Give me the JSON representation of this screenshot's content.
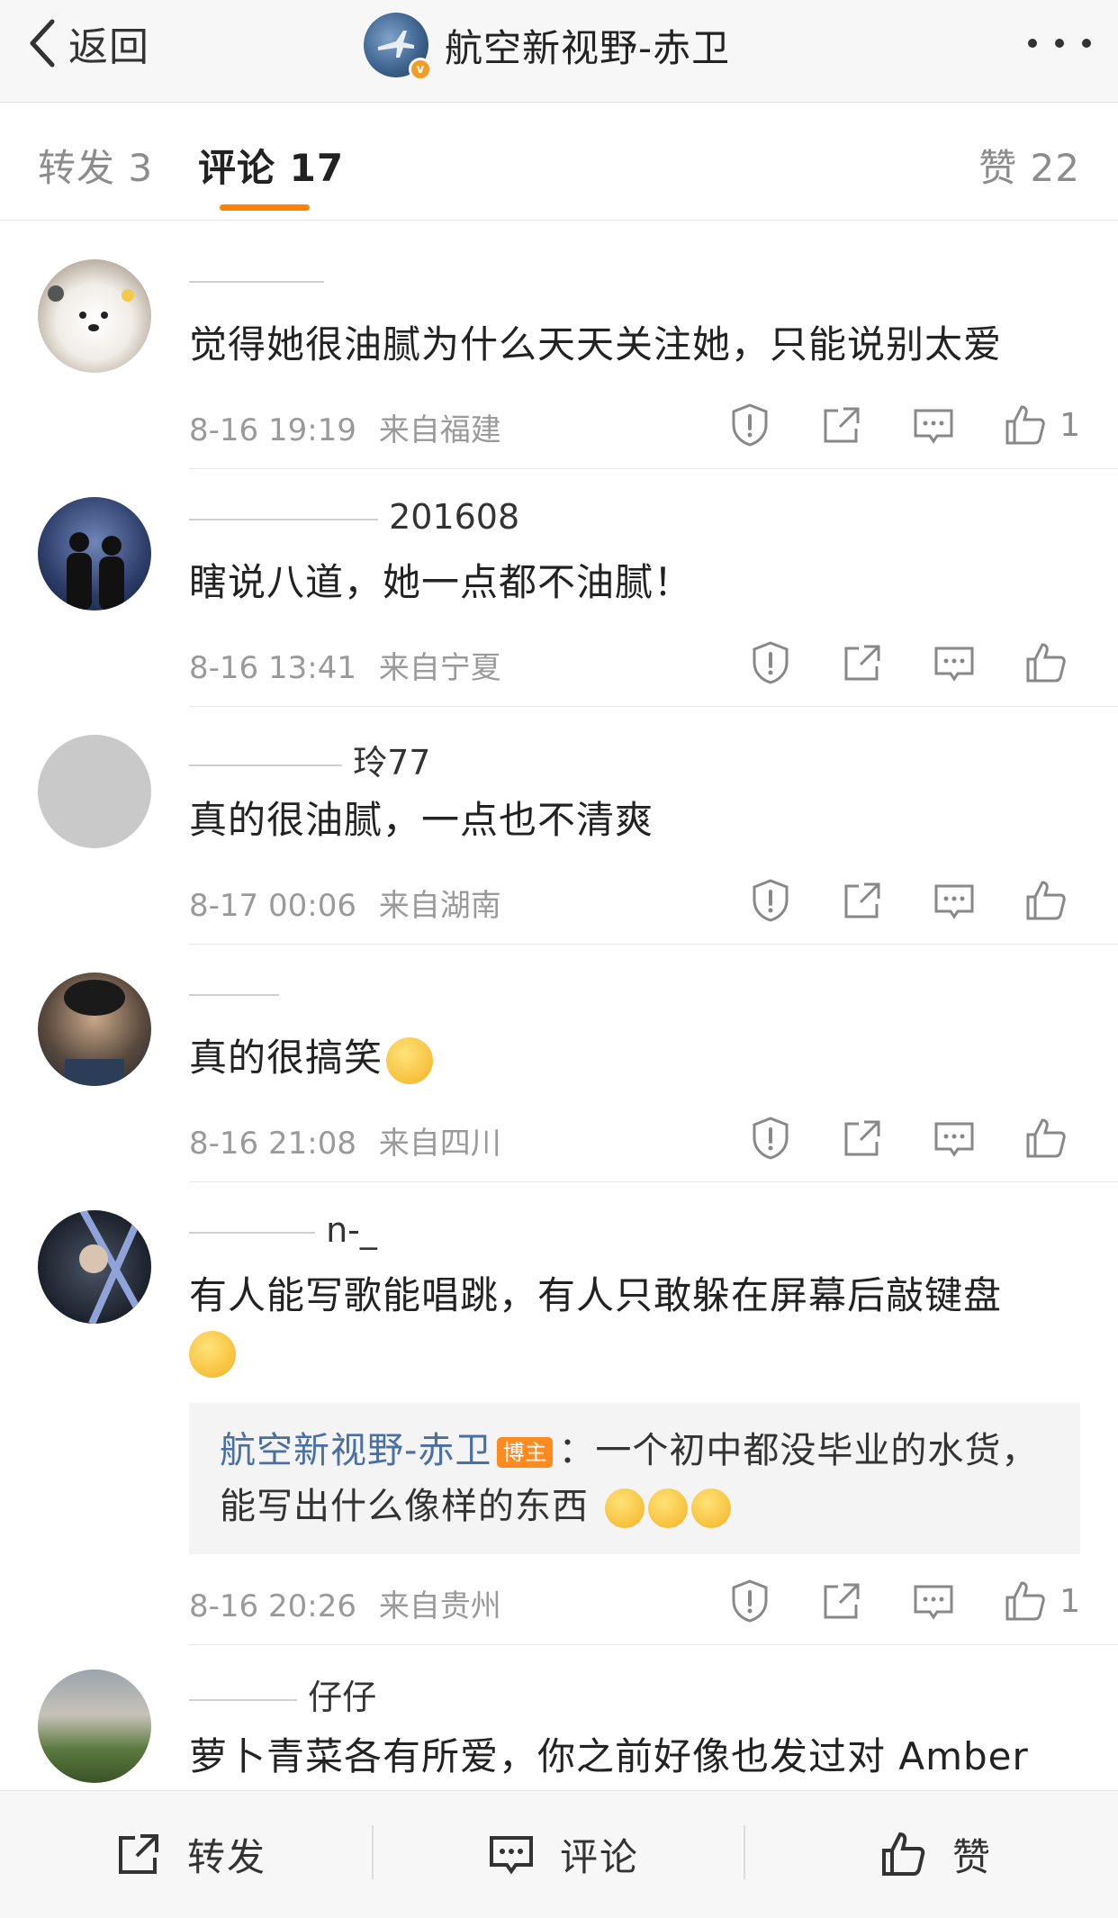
{
  "nav": {
    "back_label": "返回",
    "title": "航空新视野-赤卫",
    "verified_badge": "v"
  },
  "tabs": {
    "repost": "转发 3",
    "comment": "评论 17",
    "like": "赞 22"
  },
  "comments": [
    {
      "name": "",
      "text": "觉得她很油腻为什么天天关注她，只能说别太爱",
      "time": "8-16 19:19",
      "location": "来自福建",
      "likes": "1"
    },
    {
      "name": "201608",
      "text": "瞎说八道，她一点都不油腻！",
      "time": "8-16 13:41",
      "location": "来自宁夏",
      "likes": ""
    },
    {
      "name": "玲77",
      "text": "真的很油腻，一点也不清爽",
      "time": "8-17 00:06",
      "location": "来自湖南",
      "likes": ""
    },
    {
      "name": "",
      "text": "真的很搞笑",
      "time": "8-16 21:08",
      "location": "来自四川",
      "likes": ""
    },
    {
      "name": "n-_",
      "text": "有人能写歌能唱跳，有人只敢躲在屏幕后敲键盘",
      "time": "8-16 20:26",
      "location": "来自贵州",
      "likes": "1",
      "reply": {
        "name": "航空新视野-赤卫",
        "badge": "博主",
        "text": "：一个初中都没毕业的水货，能写出什么像样的东西"
      }
    },
    {
      "name": "仔仔",
      "text": "萝卜青菜各有所爱，你之前好像也发过对 Amber"
    }
  ],
  "bottom_bar": {
    "repost": "转发",
    "comment": "评论",
    "like": "赞"
  },
  "colors": {
    "accent": "#ff8200",
    "link": "#4a6fa5",
    "meta": "#9a9a9a"
  }
}
